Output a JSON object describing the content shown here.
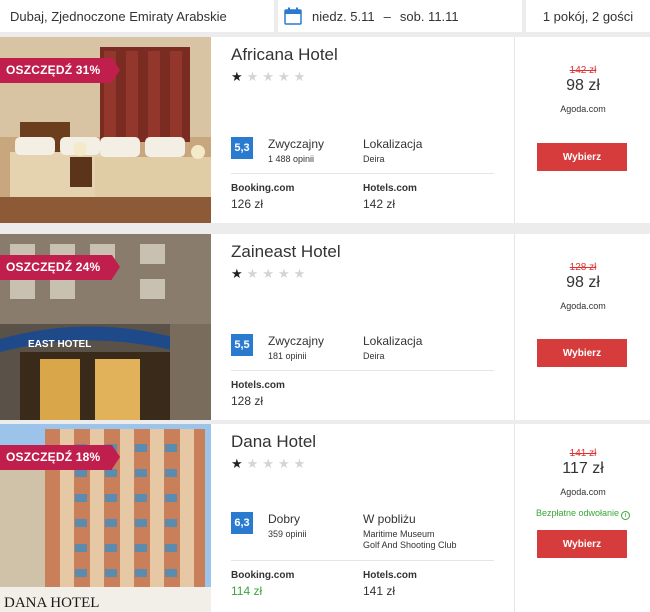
{
  "search": {
    "destination": "Dubaj, Zjednoczone Emiraty Arabskie",
    "date_from": "niedz. 5.11",
    "date_sep": "–",
    "date_to": "sob. 11.11",
    "guests": "1 pokój, 2 gości"
  },
  "colors": {
    "ribbon": "#c01f4e",
    "rating_badge": "#2a7bd0",
    "book_button": "#d63c3c",
    "old_price": "#dd3333",
    "green": "#3aa639"
  },
  "hotels": [
    {
      "discount": "OSZCZĘDŹ 31%",
      "name": "Africana Hotel",
      "stars": 1,
      "rating": "5,3",
      "rating_label": "Zwyczajny",
      "reviews": "1 488 opinii",
      "location_label": "Lokalizacja",
      "location_value": "Deira",
      "offers": [
        {
          "provider": "Booking.com",
          "price": "126 zł",
          "green": false
        },
        {
          "provider": "Hotels.com",
          "price": "142 zł",
          "green": false
        }
      ],
      "old_price": "142 zł",
      "price": "98 zł",
      "best_provider": "Agoda.com",
      "free_cancel": "",
      "button": "Wybierz"
    },
    {
      "discount": "OSZCZĘDŹ 24%",
      "name": "Zaineast Hotel",
      "stars": 1,
      "rating": "5,5",
      "rating_label": "Zwyczajny",
      "reviews": "181 opinii",
      "location_label": "Lokalizacja",
      "location_value": "Deira",
      "offers": [
        {
          "provider": "Hotels.com",
          "price": "128 zł",
          "green": false
        }
      ],
      "old_price": "128 zł",
      "price": "98 zł",
      "best_provider": "Agoda.com",
      "free_cancel": "",
      "button": "Wybierz"
    },
    {
      "discount": "OSZCZĘDŹ 18%",
      "name": "Dana Hotel",
      "stars": 1,
      "rating": "6,3",
      "rating_label": "Dobry",
      "reviews": "359 opinii",
      "location_label": "W pobliżu",
      "location_value": "Maritime Museum\nGolf And Shooting Club",
      "offers": [
        {
          "provider": "Booking.com",
          "price": "114 zł",
          "green": true
        },
        {
          "provider": "Hotels.com",
          "price": "141 zł",
          "green": false
        }
      ],
      "old_price": "141 zł",
      "price": "117 zł",
      "best_provider": "Agoda.com",
      "free_cancel": "Bezpłatne odwołanie",
      "button": "Wybierz"
    }
  ],
  "image_texts": {
    "zaineast_sign": "EAST HOTEL",
    "dana_sign": "DANA HOTEL"
  }
}
